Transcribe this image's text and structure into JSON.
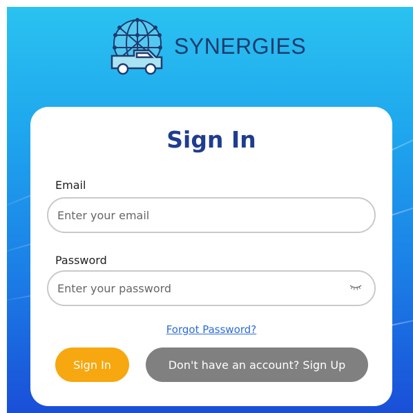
{
  "brand": {
    "name": "SYNERGIES",
    "logo_icon": "globe-truck-logo-icon"
  },
  "form": {
    "title": "Sign In",
    "email": {
      "label": "Email",
      "placeholder": "Enter your email",
      "value": ""
    },
    "password": {
      "label": "Password",
      "placeholder": "Enter your password",
      "value": "",
      "toggle_icon": "eye-closed-icon"
    },
    "forgot_link": "Forgot Password?",
    "signin_button": "Sign In",
    "signup_button": "Don't have an account? Sign Up"
  },
  "colors": {
    "background_top": "#2ac2f0",
    "background_bottom": "#1a4fd8",
    "title": "#1f3d8f",
    "brand": "#1f3b6e",
    "signin_button": "#f7a70f",
    "signup_button": "#808080",
    "link": "#2a6bd6"
  }
}
